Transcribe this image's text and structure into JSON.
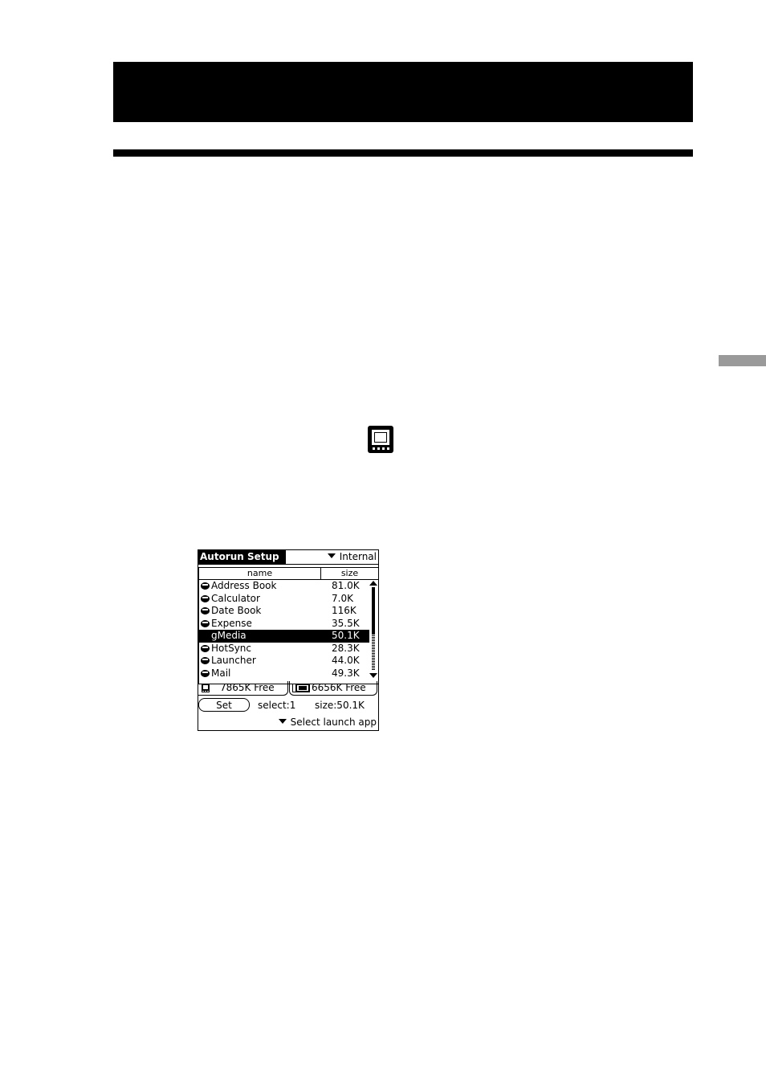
{
  "screen": {
    "title": "Autorun Setup",
    "location": "Internal",
    "columns": {
      "name": "name",
      "size": "size"
    },
    "apps": [
      {
        "name": "Address Book",
        "size": "81.0K",
        "selected": false
      },
      {
        "name": "Calculator",
        "size": "7.0K",
        "selected": false
      },
      {
        "name": "Date Book",
        "size": "116K",
        "selected": false
      },
      {
        "name": "Expense",
        "size": "35.5K",
        "selected": false
      },
      {
        "name": "gMedia",
        "size": "50.1K",
        "selected": true
      },
      {
        "name": "HotSync",
        "size": "28.3K",
        "selected": false
      },
      {
        "name": "Launcher",
        "size": "44.0K",
        "selected": false
      },
      {
        "name": "Mail",
        "size": "49.3K",
        "selected": false
      }
    ],
    "internal_free": "7865K Free",
    "card_free": "6656K Free",
    "set_label": "Set",
    "select_info": "select:1",
    "size_info": "size:50.1K",
    "launch_label": "Select launch app"
  },
  "icons": {
    "header_icon": "memory-stick-card-icon",
    "app_icon": "palm-app-icon",
    "internal_icon": "internal-memory-icon",
    "card_icon": "memory-card-icon"
  }
}
